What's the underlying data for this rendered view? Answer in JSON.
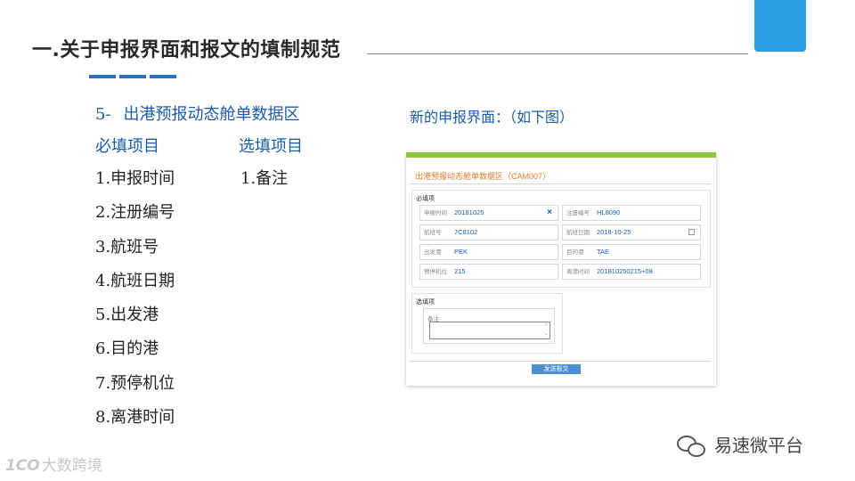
{
  "title": "一.关于申报界面和报文的填制规范",
  "section": {
    "num": "5-",
    "name": "出港预报动态舱单数据区"
  },
  "required_header": "必填项目",
  "optional_header": "选填项目",
  "required_items": [
    "1.申报时间",
    "2.注册编号",
    "3.航班号",
    "4.航班日期",
    "5.出发港",
    "6.目的港",
    "7.预停机位",
    "8.离港时间"
  ],
  "optional_items": [
    "1.备注"
  ],
  "new_interface_label": "新的申报界面：（如下图）",
  "form": {
    "title": "出港预报动态舱单数据区（CAM007）",
    "required_group": "必填项",
    "optional_group": "选填项",
    "fields": [
      {
        "label": "申报时间",
        "value": "20181025"
      },
      {
        "label": "注册编号",
        "value": "HL8090"
      },
      {
        "label": "航班号",
        "value": "7C8102"
      },
      {
        "label": "航班日期",
        "value": "2018-10-25"
      },
      {
        "label": "出发港",
        "value": "PEK"
      },
      {
        "label": "目的港",
        "value": "TAE"
      },
      {
        "label": "预停机位",
        "value": "215"
      },
      {
        "label": "离港时间",
        "value": "201810250215+08"
      }
    ],
    "remark_label": "备注",
    "send_button": "发送报文"
  },
  "watermark_left": {
    "logo": "1CO",
    "text": "大数跨境"
  },
  "watermark_right": "易速微平台",
  "colors": {
    "accent_blue": "#1a5ca8",
    "tab_blue": "#2a9ee4",
    "form_top": "#8dc63f",
    "form_title": "#e07b2a"
  }
}
